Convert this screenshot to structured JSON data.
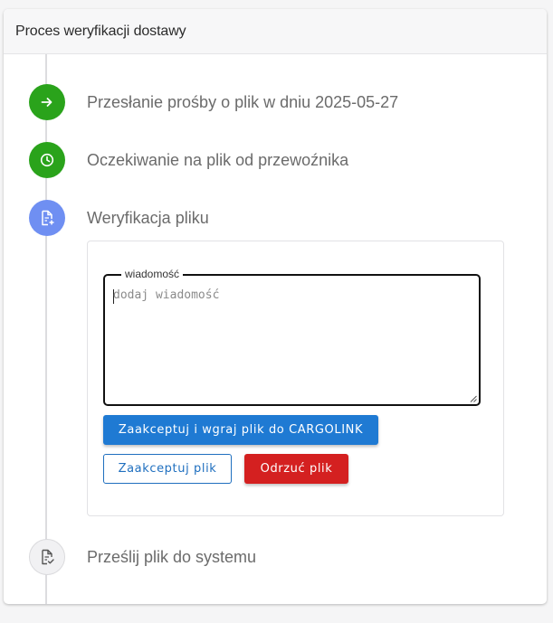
{
  "card": {
    "title": "Proces weryfikacji dostawy"
  },
  "steps": [
    {
      "label": "Przesłanie prośby o plik w dniu 2025-05-27",
      "icon": "arrow-right-icon",
      "status": "done",
      "color": "#2aa31b"
    },
    {
      "label": "Oczekiwanie na plik od przewoźnika",
      "icon": "clock-icon",
      "status": "done",
      "color": "#2aa31b"
    },
    {
      "label": "Weryfikacja pliku",
      "icon": "file-plus-icon",
      "status": "active",
      "color": "#6f8ff2"
    },
    {
      "label": "Prześlij plik do systemu",
      "icon": "file-check-icon",
      "status": "pending",
      "color": "#f1f1f3"
    }
  ],
  "form": {
    "message_legend": "wiadomość",
    "message_placeholder": "dodaj wiadomość",
    "accept_upload_label": "Zaakceptuj i wgraj plik do CARGOLINK",
    "accept_label": "Zaakceptuj plik",
    "reject_label": "Odrzuć plik"
  },
  "colors": {
    "primary": "#1f7ad3",
    "danger": "#d42020",
    "success": "#2aa31b",
    "active": "#6f8ff2"
  }
}
